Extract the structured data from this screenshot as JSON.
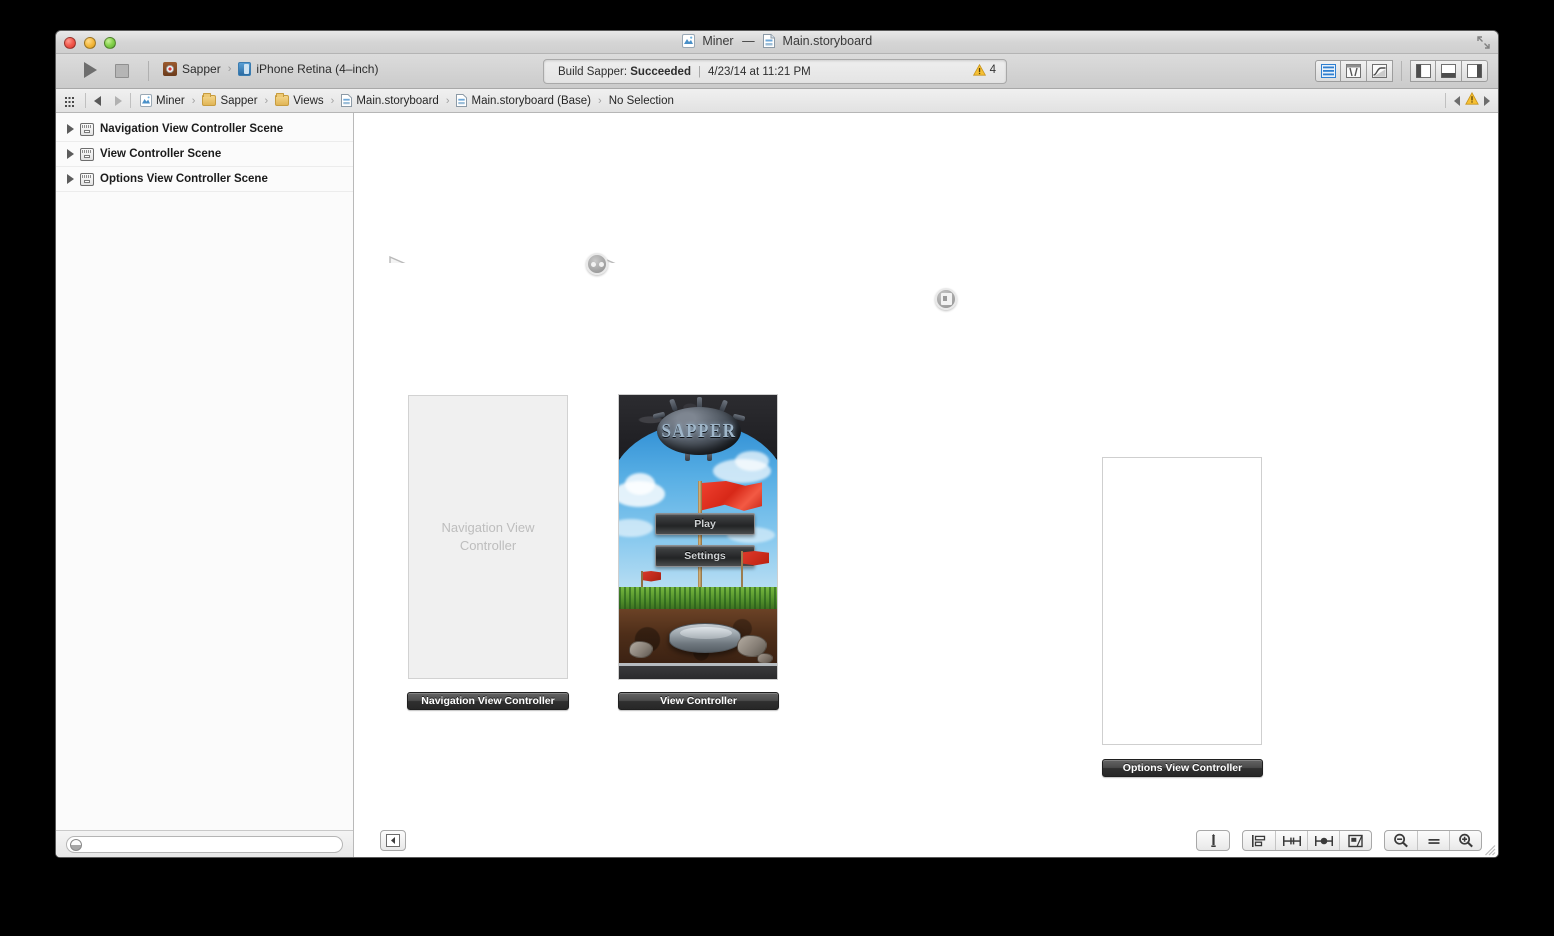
{
  "window": {
    "title_app": "Miner",
    "title_dash": "—",
    "title_file": "Main.storyboard",
    "traffic": {
      "close": "close-button",
      "minimize": "minimize-button",
      "zoom": "zoom-button"
    }
  },
  "toolbar": {
    "run_label": "Run",
    "stop_label": "Stop",
    "scheme_project": "Sapper",
    "scheme_chevron": "›",
    "scheme_destination": "iPhone Retina (4–inch)",
    "status_prefix": "Build Sapper: ",
    "status_result": "Succeeded",
    "status_divider": "|",
    "status_time": "4/23/14 at 11:21 PM",
    "warning_count": "4",
    "editor_buttons": [
      "standard-editor",
      "assistant-editor",
      "version-editor"
    ],
    "view_buttons": [
      "navigator-toggle",
      "debug-area-toggle",
      "utilities-toggle"
    ]
  },
  "jumpbar": {
    "grid_label": "related-items",
    "back_label": "Back",
    "forward_label": "Forward",
    "crumbs": [
      {
        "label": "Miner",
        "icon": "project-icon"
      },
      {
        "label": "Sapper",
        "icon": "folder-icon"
      },
      {
        "label": "Views",
        "icon": "folder-icon"
      },
      {
        "label": "Main.storyboard",
        "icon": "storyboard-icon"
      },
      {
        "label": "Main.storyboard (Base)",
        "icon": "storyboard-icon"
      },
      {
        "label": "No Selection",
        "icon": ""
      }
    ],
    "separator": "›",
    "issue_prev": "previous-issue",
    "issue_next": "next-issue"
  },
  "navigator": {
    "scenes": [
      {
        "label": "Navigation View Controller Scene"
      },
      {
        "label": "View Controller Scene"
      },
      {
        "label": "Options View Controller Scene"
      }
    ],
    "filter_placeholder": "",
    "filter_value": ""
  },
  "canvas": {
    "nav_vc": {
      "placeholder_line1": "Navigation View",
      "placeholder_line2": "Controller",
      "badge": "Navigation View Controller"
    },
    "main_vc": {
      "badge": "View Controller",
      "artwork": {
        "logo_text": "SAPPER",
        "buttons": [
          {
            "label": "Play"
          },
          {
            "label": "Settings"
          }
        ]
      }
    },
    "options_vc": {
      "badge": "Options View Controller"
    },
    "segues": [
      {
        "name": "relationship-segue",
        "type": "relationship"
      },
      {
        "name": "modal-segue",
        "type": "modal"
      }
    ]
  },
  "bottombar": {
    "outline_toggle": "document-outline-toggle",
    "buttons": [
      "auto-layout-align",
      "auto-layout-pin",
      "auto-layout-resolve",
      "auto-layout-embed",
      "zoom-out",
      "actual-size",
      "zoom-in"
    ]
  },
  "colors": {
    "accent_blue": "#3b7cb0",
    "warning_yellow": "#f5bb42",
    "flag_red": "#d72818",
    "sky_blue": "#57aee4",
    "grass_green": "#4f8c2a"
  }
}
